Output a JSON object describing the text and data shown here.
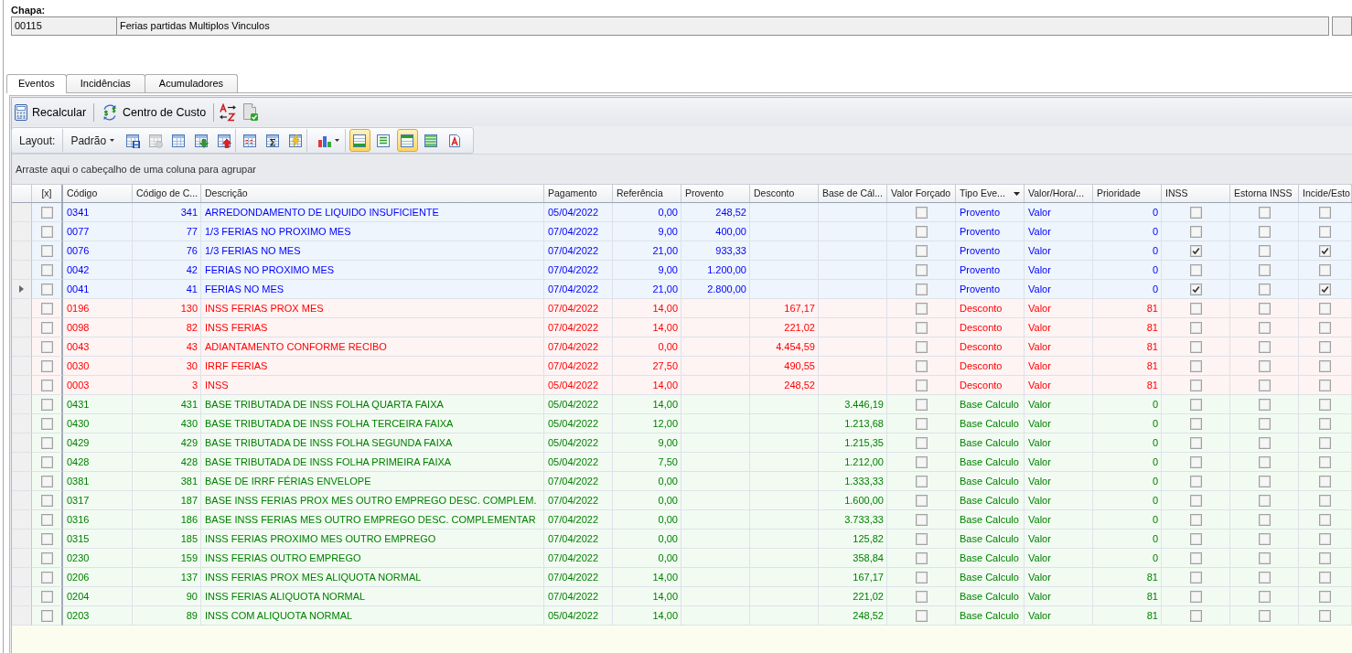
{
  "chapa": {
    "label": "Chapa:",
    "code": "00115",
    "name": "Ferias partidas Multiplos Vinculos"
  },
  "tabs": [
    {
      "label": "Eventos",
      "selected": true
    },
    {
      "label": "Incidências",
      "selected": false
    },
    {
      "label": "Acumuladores",
      "selected": false
    }
  ],
  "toolbar": {
    "buttons": [
      "Recalcular",
      "Centro de Custo"
    ]
  },
  "layout_toolbar": {
    "label": "Layout:",
    "preset": "Padrão",
    "actions": [
      {
        "disabled": false
      },
      {
        "disabled": true
      },
      {
        "disabled": false
      },
      {
        "disabled": false
      },
      {
        "disabled": false
      }
    ],
    "view_options": [
      {
        "on": true
      },
      {
        "on": false
      },
      {
        "on": true
      },
      {
        "on": false
      },
      {
        "on": false
      }
    ]
  },
  "group_panel": {
    "hint": "Arraste aqui o cabeçalho de uma coluna para agrupar"
  },
  "table": {
    "columns": [
      {
        "label": "[x]",
        "sorted": false
      },
      {
        "label": "Código",
        "sorted": false
      },
      {
        "label": "Código de C...",
        "sorted": false
      },
      {
        "label": "Descrição",
        "sorted": false
      },
      {
        "label": "Pagamento",
        "sorted": false
      },
      {
        "label": "Referência",
        "sorted": false
      },
      {
        "label": "Provento",
        "sorted": false
      },
      {
        "label": "Desconto",
        "sorted": false
      },
      {
        "label": "Base de Cál...",
        "sorted": false
      },
      {
        "label": "Valor Forçado",
        "sorted": false
      },
      {
        "label": "Tipo Eve...",
        "sorted": true
      },
      {
        "label": "Valor/Hora/...",
        "sorted": false
      },
      {
        "label": "Prioridade",
        "sorted": false
      },
      {
        "label": "INSS",
        "sorted": false
      },
      {
        "label": "Estorna INSS",
        "sorted": false
      },
      {
        "label": "Incide/Esto",
        "sorted": false
      }
    ],
    "rows": [
      {
        "kind": "provento",
        "selected": false,
        "checked": false,
        "codigo": "0341",
        "codigo_de_c": "341",
        "descricao": "ARREDONDAMENTO DE LIQUIDO INSUFICIENTE",
        "pagamento": "05/04/2022",
        "referencia": "0,00",
        "provento": "248,52",
        "valor_forcado": false,
        "tipo_evento": "Provento",
        "valor_hora": "Valor",
        "prioridade": "0",
        "inss": false,
        "estorna_inss": false,
        "incide_esto": false
      },
      {
        "kind": "provento",
        "selected": false,
        "checked": false,
        "codigo": "0077",
        "codigo_de_c": "77",
        "descricao": "1/3 FERIAS NO PROXIMO MES",
        "pagamento": "07/04/2022",
        "referencia": "9,00",
        "provento": "400,00",
        "valor_forcado": false,
        "tipo_evento": "Provento",
        "valor_hora": "Valor",
        "prioridade": "0",
        "inss": false,
        "estorna_inss": false,
        "incide_esto": false
      },
      {
        "kind": "provento",
        "selected": false,
        "checked": false,
        "codigo": "0076",
        "codigo_de_c": "76",
        "descricao": "1/3 FERIAS NO MES",
        "pagamento": "07/04/2022",
        "referencia": "21,00",
        "provento": "933,33",
        "valor_forcado": false,
        "tipo_evento": "Provento",
        "valor_hora": "Valor",
        "prioridade": "0",
        "inss": true,
        "estorna_inss": false,
        "incide_esto": true
      },
      {
        "kind": "provento",
        "selected": false,
        "checked": false,
        "codigo": "0042",
        "codigo_de_c": "42",
        "descricao": "FERIAS NO PROXIMO MES",
        "pagamento": "07/04/2022",
        "referencia": "9,00",
        "provento": "1.200,00",
        "valor_forcado": false,
        "tipo_evento": "Provento",
        "valor_hora": "Valor",
        "prioridade": "0",
        "inss": false,
        "estorna_inss": false,
        "incide_esto": false
      },
      {
        "kind": "provento",
        "selected": true,
        "checked": false,
        "codigo": "0041",
        "codigo_de_c": "41",
        "descricao": "FERIAS NO MES",
        "pagamento": "07/04/2022",
        "referencia": "21,00",
        "provento": "2.800,00",
        "valor_forcado": false,
        "tipo_evento": "Provento",
        "valor_hora": "Valor",
        "prioridade": "0",
        "inss": true,
        "estorna_inss": false,
        "incide_esto": true
      },
      {
        "kind": "desconto",
        "selected": false,
        "checked": false,
        "codigo": "0196",
        "codigo_de_c": "130",
        "descricao": "INSS FERIAS PROX MES",
        "pagamento": "07/04/2022",
        "referencia": "14,00",
        "desconto": "167,17",
        "valor_forcado": false,
        "tipo_evento": "Desconto",
        "valor_hora": "Valor",
        "prioridade": "81",
        "inss": false,
        "estorna_inss": false,
        "incide_esto": false
      },
      {
        "kind": "desconto",
        "selected": false,
        "checked": false,
        "codigo": "0098",
        "codigo_de_c": "82",
        "descricao": "INSS FERIAS",
        "pagamento": "07/04/2022",
        "referencia": "14,00",
        "desconto": "221,02",
        "valor_forcado": false,
        "tipo_evento": "Desconto",
        "valor_hora": "Valor",
        "prioridade": "81",
        "inss": false,
        "estorna_inss": false,
        "incide_esto": false
      },
      {
        "kind": "desconto",
        "selected": false,
        "checked": false,
        "codigo": "0043",
        "codigo_de_c": "43",
        "descricao": "ADIANTAMENTO CONFORME RECIBO",
        "pagamento": "07/04/2022",
        "referencia": "0,00",
        "desconto": "4.454,59",
        "valor_forcado": false,
        "tipo_evento": "Desconto",
        "valor_hora": "Valor",
        "prioridade": "81",
        "inss": false,
        "estorna_inss": false,
        "incide_esto": false
      },
      {
        "kind": "desconto",
        "selected": false,
        "checked": false,
        "codigo": "0030",
        "codigo_de_c": "30",
        "descricao": "IRRF FERIAS",
        "pagamento": "07/04/2022",
        "referencia": "27,50",
        "desconto": "490,55",
        "valor_forcado": false,
        "tipo_evento": "Desconto",
        "valor_hora": "Valor",
        "prioridade": "81",
        "inss": false,
        "estorna_inss": false,
        "incide_esto": false
      },
      {
        "kind": "desconto",
        "selected": false,
        "checked": false,
        "codigo": "0003",
        "codigo_de_c": "3",
        "descricao": "INSS",
        "pagamento": "05/04/2022",
        "referencia": "14,00",
        "desconto": "248,52",
        "valor_forcado": false,
        "tipo_evento": "Desconto",
        "valor_hora": "Valor",
        "prioridade": "81",
        "inss": false,
        "estorna_inss": false,
        "incide_esto": false
      },
      {
        "kind": "base",
        "selected": false,
        "checked": false,
        "codigo": "0431",
        "codigo_de_c": "431",
        "descricao": "BASE TRIBUTADA DE INSS FOLHA QUARTA FAIXA",
        "pagamento": "05/04/2022",
        "referencia": "14,00",
        "base_de_cal": "3.446,19",
        "valor_forcado": false,
        "tipo_evento": "Base Calculo",
        "valor_hora": "Valor",
        "prioridade": "0",
        "inss": false,
        "estorna_inss": false,
        "incide_esto": false
      },
      {
        "kind": "base",
        "selected": false,
        "checked": false,
        "codigo": "0430",
        "codigo_de_c": "430",
        "descricao": "BASE TRIBUTADA DE INSS FOLHA TERCEIRA FAIXA",
        "pagamento": "05/04/2022",
        "referencia": "12,00",
        "base_de_cal": "1.213,68",
        "valor_forcado": false,
        "tipo_evento": "Base Calculo",
        "valor_hora": "Valor",
        "prioridade": "0",
        "inss": false,
        "estorna_inss": false,
        "incide_esto": false
      },
      {
        "kind": "base",
        "selected": false,
        "checked": false,
        "codigo": "0429",
        "codigo_de_c": "429",
        "descricao": "BASE TRIBUTADA DE INSS FOLHA SEGUNDA FAIXA",
        "pagamento": "05/04/2022",
        "referencia": "9,00",
        "base_de_cal": "1.215,35",
        "valor_forcado": false,
        "tipo_evento": "Base Calculo",
        "valor_hora": "Valor",
        "prioridade": "0",
        "inss": false,
        "estorna_inss": false,
        "incide_esto": false
      },
      {
        "kind": "base",
        "selected": false,
        "checked": false,
        "codigo": "0428",
        "codigo_de_c": "428",
        "descricao": "BASE TRIBUTADA DE INSS FOLHA PRIMEIRA FAIXA",
        "pagamento": "05/04/2022",
        "referencia": "7,50",
        "base_de_cal": "1.212,00",
        "valor_forcado": false,
        "tipo_evento": "Base Calculo",
        "valor_hora": "Valor",
        "prioridade": "0",
        "inss": false,
        "estorna_inss": false,
        "incide_esto": false
      },
      {
        "kind": "base",
        "selected": false,
        "checked": false,
        "codigo": "0381",
        "codigo_de_c": "381",
        "descricao": "BASE DE IRRF FÉRIAS ENVELOPE",
        "pagamento": "07/04/2022",
        "referencia": "0,00",
        "base_de_cal": "1.333,33",
        "valor_forcado": false,
        "tipo_evento": "Base Calculo",
        "valor_hora": "Valor",
        "prioridade": "0",
        "inss": false,
        "estorna_inss": false,
        "incide_esto": false
      },
      {
        "kind": "base",
        "selected": false,
        "checked": false,
        "codigo": "0317",
        "codigo_de_c": "187",
        "descricao": "BASE INSS FERIAS PROX MES OUTRO EMPREGO DESC. COMPLEM.",
        "pagamento": "07/04/2022",
        "referencia": "0,00",
        "base_de_cal": "1.600,00",
        "valor_forcado": false,
        "tipo_evento": "Base Calculo",
        "valor_hora": "Valor",
        "prioridade": "0",
        "inss": false,
        "estorna_inss": false,
        "incide_esto": false
      },
      {
        "kind": "base",
        "selected": false,
        "checked": false,
        "codigo": "0316",
        "codigo_de_c": "186",
        "descricao": "BASE INSS FERIAS MES OUTRO EMPREGO DESC. COMPLEMENTAR",
        "pagamento": "07/04/2022",
        "referencia": "0,00",
        "base_de_cal": "3.733,33",
        "valor_forcado": false,
        "tipo_evento": "Base Calculo",
        "valor_hora": "Valor",
        "prioridade": "0",
        "inss": false,
        "estorna_inss": false,
        "incide_esto": false
      },
      {
        "kind": "base",
        "selected": false,
        "checked": false,
        "codigo": "0315",
        "codigo_de_c": "185",
        "descricao": "INSS FERIAS PROXIMO MES OUTRO EMPREGO",
        "pagamento": "07/04/2022",
        "referencia": "0,00",
        "base_de_cal": "125,82",
        "valor_forcado": false,
        "tipo_evento": "Base Calculo",
        "valor_hora": "Valor",
        "prioridade": "0",
        "inss": false,
        "estorna_inss": false,
        "incide_esto": false
      },
      {
        "kind": "base",
        "selected": false,
        "checked": false,
        "codigo": "0230",
        "codigo_de_c": "159",
        "descricao": "INSS FERIAS OUTRO EMPREGO",
        "pagamento": "07/04/2022",
        "referencia": "0,00",
        "base_de_cal": "358,84",
        "valor_forcado": false,
        "tipo_evento": "Base Calculo",
        "valor_hora": "Valor",
        "prioridade": "0",
        "inss": false,
        "estorna_inss": false,
        "incide_esto": false
      },
      {
        "kind": "base",
        "selected": false,
        "checked": false,
        "codigo": "0206",
        "codigo_de_c": "137",
        "descricao": "INSS FERIAS PROX MES ALIQUOTA NORMAL",
        "pagamento": "07/04/2022",
        "referencia": "14,00",
        "base_de_cal": "167,17",
        "valor_forcado": false,
        "tipo_evento": "Base Calculo",
        "valor_hora": "Valor",
        "prioridade": "81",
        "inss": false,
        "estorna_inss": false,
        "incide_esto": false
      },
      {
        "kind": "base",
        "selected": false,
        "checked": false,
        "codigo": "0204",
        "codigo_de_c": "90",
        "descricao": "INSS FERIAS ALIQUOTA NORMAL",
        "pagamento": "07/04/2022",
        "referencia": "14,00",
        "base_de_cal": "221,02",
        "valor_forcado": false,
        "tipo_evento": "Base Calculo",
        "valor_hora": "Valor",
        "prioridade": "81",
        "inss": false,
        "estorna_inss": false,
        "incide_esto": false
      },
      {
        "kind": "base",
        "selected": false,
        "checked": false,
        "codigo": "0203",
        "codigo_de_c": "89",
        "descricao": "INSS COM ALIQUOTA NORMAL",
        "pagamento": "05/04/2022",
        "referencia": "14,00",
        "base_de_cal": "248,52",
        "valor_forcado": false,
        "tipo_evento": "Base Calculo",
        "valor_hora": "Valor",
        "prioridade": "81",
        "inss": false,
        "estorna_inss": false,
        "incide_esto": false
      }
    ]
  }
}
